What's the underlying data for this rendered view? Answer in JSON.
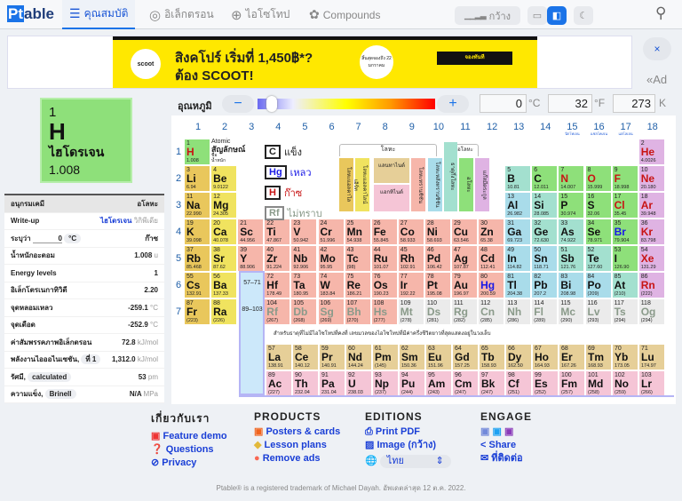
{
  "header": {
    "logo_pt": "Pt",
    "logo_rest": "able",
    "tabs": [
      {
        "label": "คุณสมบัติ",
        "icon": "list-icon"
      },
      {
        "label": "อิเล็กตรอน",
        "icon": "atom-icon"
      },
      {
        "label": "ไอโซโทป",
        "icon": "isotope-icon"
      },
      {
        "label": "Compounds",
        "icon": "molecule-icon"
      }
    ],
    "wide_label": "กว้าง"
  },
  "ad": {
    "headline1": "สิงคโปร์ เริ่มที่ 1,450฿*?",
    "headline2": "ต้อง SCOOT!",
    "brand": "scoot",
    "badge": "สิ้นสุดจองถึง 22 มกราคม",
    "cta": "จองทันที",
    "close": "×",
    "collapse": "«Ad"
  },
  "temperature": {
    "label": "อุณหภูมิ",
    "minus": "−",
    "plus": "+",
    "celsius": "0",
    "fahrenheit": "32",
    "kelvin": "273",
    "c_unit": "°C",
    "f_unit": "°F",
    "k_unit": "K",
    "slider_fraction": 0.05
  },
  "selected": {
    "number": "1",
    "symbol": "H",
    "name": "ไฮโดรเจน",
    "mass": "1.008"
  },
  "props": {
    "header_left": "อนุกรมเคมี",
    "header_right": "อโลหะ",
    "writeup_label": "Write-up",
    "writeup_link": "ไฮโดรเจน",
    "writeup_src": "วิกิพีเดีย",
    "state_label": "ระบุว่า",
    "state_temp": "0",
    "state_unit": "°C",
    "state_value": "ก๊าซ",
    "rows": [
      {
        "label": "น้ำหนักอะตอม",
        "value": "1.008",
        "unit": "u"
      },
      {
        "label": "Energy levels",
        "value": "1",
        "unit": ""
      },
      {
        "label": "อิเล็กโตรเนกาทิวิตี",
        "value": "2.20",
        "unit": ""
      },
      {
        "label": "จุดหลอมเหลว",
        "value": "-259.1",
        "unit": "°C"
      },
      {
        "label": "จุดเดือด",
        "value": "-252.9",
        "unit": "°C"
      },
      {
        "label": "ค่าสัมพรรคภาพอิเล็กตรอน",
        "value": "72.8",
        "unit": "kJ/mol"
      }
    ],
    "ion_label": "พลังงานไอออไนเซชัน,",
    "ion_sel": "ที่ 1",
    "ion_value": "1,312.0",
    "ion_unit": "kJ/mol",
    "radius_label": "รัศมี,",
    "radius_sel": "calculated",
    "radius_value": "53",
    "radius_unit": "pm",
    "hard_label": "ความแข็ง,",
    "hard_sel": "Brinell",
    "hard_value": "N/A",
    "hard_unit": "MPa"
  },
  "table": {
    "groups": [
      "1",
      "2",
      "3",
      "4",
      "5",
      "6",
      "7",
      "8",
      "9",
      "10",
      "11",
      "12",
      "13",
      "14",
      "15",
      "16",
      "17",
      "18"
    ],
    "group_subs": {
      "15": "นิกโทเจน",
      "16": "แชลโคเจน",
      "17": "แฮโลเจน"
    },
    "periods": [
      "1",
      "2",
      "3",
      "4",
      "5",
      "6",
      "7"
    ],
    "key": {
      "atomic": "Atomic",
      "symbol": "สัญลักษณ์",
      "name": "ชื่อ",
      "weight": "น้ำหนัก"
    },
    "states": [
      {
        "sym": "C",
        "label": "แข็ง",
        "color": "#222222"
      },
      {
        "sym": "Hg",
        "label": "เหลว",
        "color": "#1a1ae6"
      },
      {
        "sym": "H",
        "label": "ก๊าซ",
        "color": "#c81414"
      },
      {
        "sym": "Rf",
        "label": "ไม่ทราบ",
        "color": "#8a9a8a"
      }
    ],
    "metals_label": "โลหะ",
    "nonmetals_label": "อโลหะ",
    "categories": [
      {
        "label": "โลหะแอลคาไล",
        "color": "#e9c75c"
      },
      {
        "label": "โลหะแอลคาไลน์เอิร์ท",
        "color": "#f0e35f"
      },
      {
        "label": "แลนทาไนด์",
        "color": "#e6cf98"
      },
      {
        "label": "แอกทิไนด์",
        "color": "#f5c5d6"
      },
      {
        "label": "โลหะทรานซิชัน",
        "color": "#f6b6aa"
      },
      {
        "label": "โลหะหลังทรานซิชัน",
        "color": "#a9dcea"
      },
      {
        "label": "ธาตุกึ่งโลหะ",
        "color": "#a3e0cf"
      },
      {
        "label": "อโลหะ",
        "color": "#8ee07a"
      },
      {
        "label": "แก๊สมีตระกูล",
        "color": "#dfb3e3"
      }
    ],
    "cat_colors": {
      "a": "#e9c75c",
      "e": "#f0e35f",
      "t": "#f6b6aa",
      "p": "#a9dcea",
      "m": "#a3e0cf",
      "n": "#8ee07a",
      "g": "#dfb3e3",
      "l": "#e6cf98",
      "c": "#f5c5d6",
      "u": "#ebebeb"
    },
    "state_colors": {
      "s": "#111111",
      "l": "#1a1ae6",
      "g": "#c81414",
      "u": "#8a9a8a"
    },
    "lan_range": "57–71",
    "act_range": "89–103",
    "note": "สำหรับธาตุที่ไม่มีไอโซโทปที่คงที่ เลขมวลของไอโซโทปที่มีค่าครึ่งชีวิตยาวที่สุดแสดงอยู่ในวงเล็บ",
    "elements": [
      [
        1,
        "H",
        "1.008",
        "n",
        "g"
      ],
      [
        2,
        "He",
        "4.0026",
        "g",
        "g"
      ],
      [
        3,
        "Li",
        "6.94",
        "a",
        "s"
      ],
      [
        4,
        "Be",
        "9.0122",
        "e",
        "s"
      ],
      [
        5,
        "B",
        "10.81",
        "m",
        "s"
      ],
      [
        6,
        "C",
        "12.011",
        "n",
        "s"
      ],
      [
        7,
        "N",
        "14.007",
        "n",
        "g"
      ],
      [
        8,
        "O",
        "15.999",
        "n",
        "g"
      ],
      [
        9,
        "F",
        "18.998",
        "n",
        "g"
      ],
      [
        10,
        "Ne",
        "20.180",
        "g",
        "g"
      ],
      [
        11,
        "Na",
        "22.990",
        "a",
        "s"
      ],
      [
        12,
        "Mg",
        "24.305",
        "e",
        "s"
      ],
      [
        13,
        "Al",
        "26.982",
        "p",
        "s"
      ],
      [
        14,
        "Si",
        "28.085",
        "m",
        "s"
      ],
      [
        15,
        "P",
        "30.974",
        "n",
        "s"
      ],
      [
        16,
        "S",
        "32.06",
        "n",
        "s"
      ],
      [
        17,
        "Cl",
        "35.45",
        "n",
        "g"
      ],
      [
        18,
        "Ar",
        "39.948",
        "g",
        "g"
      ],
      [
        19,
        "K",
        "39.098",
        "a",
        "s"
      ],
      [
        20,
        "Ca",
        "40.078",
        "e",
        "s"
      ],
      [
        21,
        "Sc",
        "44.956",
        "t",
        "s"
      ],
      [
        22,
        "Ti",
        "47.867",
        "t",
        "s"
      ],
      [
        23,
        "V",
        "50.942",
        "t",
        "s"
      ],
      [
        24,
        "Cr",
        "51.996",
        "t",
        "s"
      ],
      [
        25,
        "Mn",
        "54.938",
        "t",
        "s"
      ],
      [
        26,
        "Fe",
        "55.845",
        "t",
        "s"
      ],
      [
        27,
        "Co",
        "58.933",
        "t",
        "s"
      ],
      [
        28,
        "Ni",
        "58.693",
        "t",
        "s"
      ],
      [
        29,
        "Cu",
        "63.546",
        "t",
        "s"
      ],
      [
        30,
        "Zn",
        "65.38",
        "t",
        "s"
      ],
      [
        31,
        "Ga",
        "69.723",
        "p",
        "s"
      ],
      [
        32,
        "Ge",
        "72.630",
        "m",
        "s"
      ],
      [
        33,
        "As",
        "74.922",
        "m",
        "s"
      ],
      [
        34,
        "Se",
        "78.971",
        "n",
        "s"
      ],
      [
        35,
        "Br",
        "79.904",
        "n",
        "l"
      ],
      [
        36,
        "Kr",
        "83.798",
        "g",
        "g"
      ],
      [
        37,
        "Rb",
        "85.468",
        "a",
        "s"
      ],
      [
        38,
        "Sr",
        "87.62",
        "e",
        "s"
      ],
      [
        39,
        "Y",
        "88.906",
        "t",
        "s"
      ],
      [
        40,
        "Zr",
        "91.224",
        "t",
        "s"
      ],
      [
        41,
        "Nb",
        "92.906",
        "t",
        "s"
      ],
      [
        42,
        "Mo",
        "95.95",
        "t",
        "s"
      ],
      [
        43,
        "Tc",
        "(98)",
        "t",
        "s"
      ],
      [
        44,
        "Ru",
        "101.07",
        "t",
        "s"
      ],
      [
        45,
        "Rh",
        "102.91",
        "t",
        "s"
      ],
      [
        46,
        "Pd",
        "106.42",
        "t",
        "s"
      ],
      [
        47,
        "Ag",
        "107.87",
        "t",
        "s"
      ],
      [
        48,
        "Cd",
        "112.41",
        "t",
        "s"
      ],
      [
        49,
        "In",
        "114.82",
        "p",
        "s"
      ],
      [
        50,
        "Sn",
        "118.71",
        "p",
        "s"
      ],
      [
        51,
        "Sb",
        "121.76",
        "m",
        "s"
      ],
      [
        52,
        "Te",
        "127.60",
        "m",
        "s"
      ],
      [
        53,
        "I",
        "126.90",
        "n",
        "s"
      ],
      [
        54,
        "Xe",
        "131.29",
        "g",
        "g"
      ],
      [
        55,
        "Cs",
        "132.91",
        "a",
        "s"
      ],
      [
        56,
        "Ba",
        "137.33",
        "e",
        "s"
      ],
      [
        57,
        "La",
        "138.91",
        "l",
        "s"
      ],
      [
        58,
        "Ce",
        "140.12",
        "l",
        "s"
      ],
      [
        59,
        "Pr",
        "140.91",
        "l",
        "s"
      ],
      [
        60,
        "Nd",
        "144.24",
        "l",
        "s"
      ],
      [
        61,
        "Pm",
        "(145)",
        "l",
        "s"
      ],
      [
        62,
        "Sm",
        "150.36",
        "l",
        "s"
      ],
      [
        63,
        "Eu",
        "151.96",
        "l",
        "s"
      ],
      [
        64,
        "Gd",
        "157.25",
        "l",
        "s"
      ],
      [
        65,
        "Tb",
        "158.93",
        "l",
        "s"
      ],
      [
        66,
        "Dy",
        "162.50",
        "l",
        "s"
      ],
      [
        67,
        "Ho",
        "164.93",
        "l",
        "s"
      ],
      [
        68,
        "Er",
        "167.26",
        "l",
        "s"
      ],
      [
        69,
        "Tm",
        "168.93",
        "l",
        "s"
      ],
      [
        70,
        "Yb",
        "173.05",
        "l",
        "s"
      ],
      [
        71,
        "Lu",
        "174.97",
        "l",
        "s"
      ],
      [
        72,
        "Hf",
        "178.49",
        "t",
        "s"
      ],
      [
        73,
        "Ta",
        "180.95",
        "t",
        "s"
      ],
      [
        74,
        "W",
        "183.84",
        "t",
        "s"
      ],
      [
        75,
        "Re",
        "186.21",
        "t",
        "s"
      ],
      [
        76,
        "Os",
        "190.23",
        "t",
        "s"
      ],
      [
        77,
        "Ir",
        "192.22",
        "t",
        "s"
      ],
      [
        78,
        "Pt",
        "195.08",
        "t",
        "s"
      ],
      [
        79,
        "Au",
        "196.97",
        "t",
        "s"
      ],
      [
        80,
        "Hg",
        "200.59",
        "t",
        "l"
      ],
      [
        81,
        "Tl",
        "204.38",
        "p",
        "s"
      ],
      [
        82,
        "Pb",
        "207.2",
        "p",
        "s"
      ],
      [
        83,
        "Bi",
        "208.98",
        "p",
        "s"
      ],
      [
        84,
        "Po",
        "(209)",
        "p",
        "s"
      ],
      [
        85,
        "At",
        "(210)",
        "m",
        "s"
      ],
      [
        86,
        "Rn",
        "(222)",
        "g",
        "g"
      ],
      [
        87,
        "Fr",
        "(223)",
        "a",
        "s"
      ],
      [
        88,
        "Ra",
        "(226)",
        "e",
        "s"
      ],
      [
        89,
        "Ac",
        "(227)",
        "c",
        "s"
      ],
      [
        90,
        "Th",
        "232.04",
        "c",
        "s"
      ],
      [
        91,
        "Pa",
        "231.04",
        "c",
        "s"
      ],
      [
        92,
        "U",
        "238.03",
        "c",
        "s"
      ],
      [
        93,
        "Np",
        "(237)",
        "c",
        "s"
      ],
      [
        94,
        "Pu",
        "(244)",
        "c",
        "s"
      ],
      [
        95,
        "Am",
        "(243)",
        "c",
        "s"
      ],
      [
        96,
        "Cm",
        "(247)",
        "c",
        "s"
      ],
      [
        97,
        "Bk",
        "(247)",
        "c",
        "s"
      ],
      [
        98,
        "Cf",
        "(251)",
        "c",
        "s"
      ],
      [
        99,
        "Es",
        "(252)",
        "c",
        "s"
      ],
      [
        100,
        "Fm",
        "(257)",
        "c",
        "s"
      ],
      [
        101,
        "Md",
        "(258)",
        "c",
        "s"
      ],
      [
        102,
        "No",
        "(259)",
        "c",
        "s"
      ],
      [
        103,
        "Lr",
        "(266)",
        "c",
        "s"
      ],
      [
        104,
        "Rf",
        "(267)",
        "t",
        "u"
      ],
      [
        105,
        "Db",
        "(268)",
        "t",
        "u"
      ],
      [
        106,
        "Sg",
        "(269)",
        "t",
        "u"
      ],
      [
        107,
        "Bh",
        "(270)",
        "t",
        "u"
      ],
      [
        108,
        "Hs",
        "(277)",
        "t",
        "u"
      ],
      [
        109,
        "Mt",
        "(278)",
        "u",
        "u"
      ],
      [
        110,
        "Ds",
        "(281)",
        "u",
        "u"
      ],
      [
        111,
        "Rg",
        "(282)",
        "u",
        "u"
      ],
      [
        112,
        "Cn",
        "(285)",
        "u",
        "u"
      ],
      [
        113,
        "Nh",
        "(286)",
        "u",
        "u"
      ],
      [
        114,
        "Fl",
        "(289)",
        "u",
        "u"
      ],
      [
        115,
        "Mc",
        "(290)",
        "u",
        "u"
      ],
      [
        116,
        "Lv",
        "(293)",
        "u",
        "u"
      ],
      [
        117,
        "Ts",
        "(294)",
        "u",
        "u"
      ],
      [
        118,
        "Og",
        "(294)",
        "u",
        "u"
      ]
    ]
  },
  "footer": {
    "about": {
      "title": "เกี่ยวกับเรา",
      "links": [
        "Feature demo",
        "Questions",
        "Privacy"
      ]
    },
    "products": {
      "title": "PRODUCTS",
      "links": [
        "Posters & cards",
        "Lesson plans",
        "Remove ads"
      ]
    },
    "editions": {
      "title": "EDITIONS",
      "links": [
        "Print PDF",
        "Image (กว้าง)"
      ],
      "language": "ไทย"
    },
    "engage": {
      "title": "ENGAGE",
      "links": [
        "Share",
        "ที่ติดต่อ"
      ]
    },
    "copyright": "Ptable® is a registered trademark of Michael Dayah. อัพเดตล่าสุด 12 ต.ค. 2022."
  }
}
